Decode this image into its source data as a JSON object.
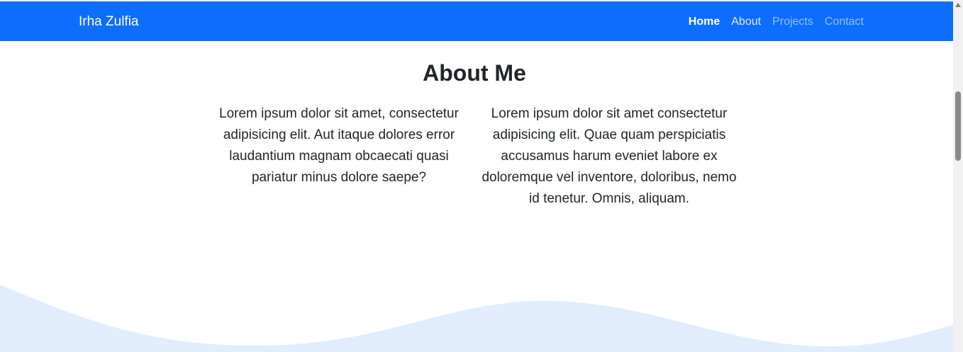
{
  "navbar": {
    "brand": "Irha Zulfia",
    "links": [
      {
        "label": "Home"
      },
      {
        "label": "About"
      },
      {
        "label": "Projects"
      },
      {
        "label": "Contact"
      }
    ]
  },
  "about": {
    "title": "About Me",
    "paragraph_left": "Lorem ipsum dolor sit amet, consectetur adipisicing elit. Aut itaque dolores error laudantium magnam obcaecati quasi pariatur minus dolore saepe?",
    "paragraph_right": "Lorem ipsum dolor sit amet consectetur adipisicing elit. Quae quam perspiciatis accusamus harum eveniet labore ex doloremque vel inventore, doloribus, nemo id tenetur. Omnis, aliquam."
  },
  "colors": {
    "navbar_bg": "#0d6efd",
    "wave_fill": "#e1edfd",
    "text": "#212529"
  }
}
